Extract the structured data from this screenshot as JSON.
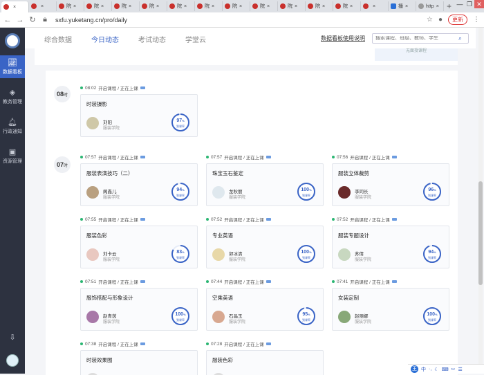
{
  "browser": {
    "tabs": [
      {
        "label": "",
        "active": true,
        "icon": "rain-classroom-icon"
      },
      {
        "label": "",
        "icon": "rain-classroom-icon"
      },
      {
        "label": "院",
        "icon": "rain-classroom-icon"
      },
      {
        "label": "院",
        "icon": "rain-classroom-icon"
      },
      {
        "label": "院",
        "icon": "rain-classroom-icon"
      },
      {
        "label": "院",
        "icon": "rain-classroom-icon"
      },
      {
        "label": "院",
        "icon": "rain-classroom-icon"
      },
      {
        "label": "院",
        "icon": "rain-classroom-icon"
      },
      {
        "label": "院",
        "icon": "rain-classroom-icon"
      },
      {
        "label": "院",
        "icon": "rain-classroom-icon"
      },
      {
        "label": "院",
        "icon": "rain-classroom-icon"
      },
      {
        "label": "院",
        "icon": "rain-classroom-icon"
      },
      {
        "label": "院",
        "icon": "rain-classroom-icon"
      },
      {
        "label": "",
        "icon": "rain-classroom-icon"
      },
      {
        "label": "播",
        "icon": "blue-app-icon"
      },
      {
        "label": "http",
        "icon": "globe-icon"
      }
    ],
    "url": "sxfu.yuketang.cn/pro/daily",
    "update_label": "更新"
  },
  "sidebar": {
    "items": [
      {
        "label": "数据看板",
        "icon": "chart-icon",
        "active": true
      },
      {
        "label": "教务管理",
        "icon": "layers-icon"
      },
      {
        "label": "行政通知",
        "icon": "bell-icon"
      },
      {
        "label": "资源管理",
        "icon": "box-icon"
      }
    ]
  },
  "topnav": {
    "tabs": [
      {
        "label": "综合数据"
      },
      {
        "label": "今日动态",
        "active": true
      },
      {
        "label": "考试动态"
      },
      {
        "label": "学堂云"
      }
    ],
    "guide_link": "数据看板使用说明",
    "search_placeholder": "搜索课程、班级、教师、学生"
  },
  "upper_note": "无面授课程",
  "hours": [
    {
      "hour": "08",
      "unit": "时"
    },
    {
      "hour": "07",
      "unit": "时"
    }
  ],
  "status_text": "开启课程 / 正在上课",
  "classes": [
    {
      "time": "08:02",
      "course": "时装摄影",
      "teacher": "刘阳",
      "dept": "服装学院",
      "percent": 97,
      "ring_label": "到课率",
      "avatar_color": "#cfc8a8"
    },
    {
      "time": "07:57",
      "course": "服装表演技巧（二）",
      "teacher": "阁鑫儿",
      "dept": "服装学院",
      "percent": 94,
      "ring_label": "到课率",
      "avatar_color": "#b9a080"
    },
    {
      "time": "07:57",
      "course": "珠宝玉石鉴定",
      "teacher": "龙秋丽",
      "dept": "服装学院",
      "percent": 100,
      "ring_label": "到课率",
      "avatar_color": "#dfe8ee"
    },
    {
      "time": "07:56",
      "course": "服装立体裁剪",
      "teacher": "李同长",
      "dept": "服装学院",
      "percent": 96,
      "ring_label": "到课率",
      "avatar_color": "#6a2a2a"
    },
    {
      "time": "07:55",
      "course": "服装色彩",
      "teacher": "刘卡云",
      "dept": "服装学院",
      "percent": 83,
      "ring_label": "到课率",
      "avatar_color": "#e9c8c0"
    },
    {
      "time": "07:52",
      "course": "专业英语",
      "teacher": "郭冰清",
      "dept": "服装学院",
      "percent": 100,
      "ring_label": "到课率",
      "avatar_color": "#e8d8a8"
    },
    {
      "time": "07:52",
      "course": "服装专题设计",
      "teacher": "苏倩",
      "dept": "服装学院",
      "percent": 94,
      "ring_label": "到课率",
      "avatar_color": "#c8d8c0"
    },
    {
      "time": "07:51",
      "course": "服饰搭配与形象设计",
      "teacher": "赵青茵",
      "dept": "服装学院",
      "percent": 100,
      "ring_label": "到课率",
      "avatar_color": "#a878a8"
    },
    {
      "time": "07:44",
      "course": "空乘英语",
      "teacher": "石晶玉",
      "dept": "服装学院",
      "percent": 95,
      "ring_label": "到课率",
      "avatar_color": "#d8a890"
    },
    {
      "time": "07:41",
      "course": "女装定制",
      "teacher": "赵丽娜",
      "dept": "服装学院",
      "percent": 100,
      "ring_label": "到课率",
      "avatar_color": "#88a878"
    },
    {
      "time": "07:38",
      "course": "时装效果图",
      "teacher": "",
      "dept": "",
      "percent": null,
      "ring_label": "",
      "avatar_color": "#ddd"
    },
    {
      "time": "07:28",
      "course": "服装色彩",
      "teacher": "",
      "dept": "",
      "percent": null,
      "ring_label": "",
      "avatar_color": "#ddd"
    }
  ],
  "colors": {
    "accent": "#3a64c6",
    "sidebar": "#2d3240",
    "live_dot": "#2bb673"
  }
}
